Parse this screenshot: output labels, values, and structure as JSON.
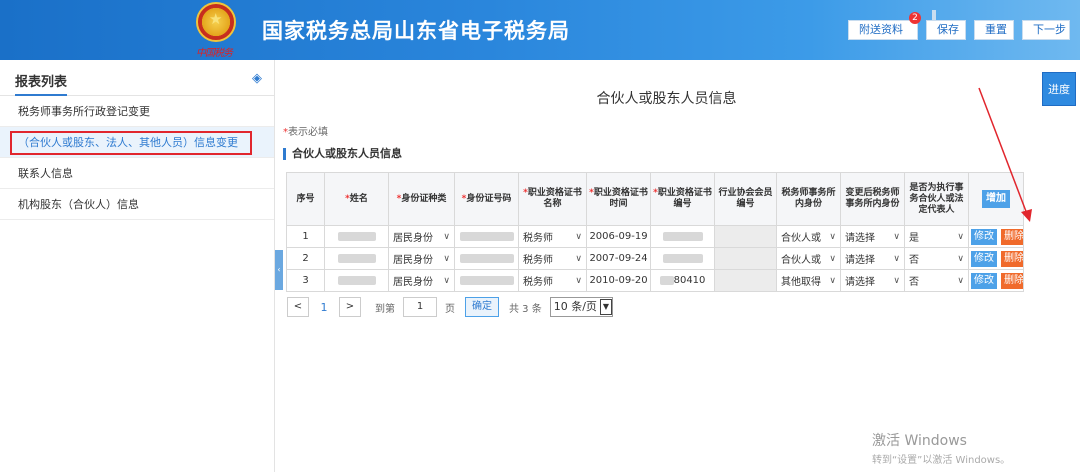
{
  "header": {
    "logo_caption": "中国税务",
    "title": "国家税务总局山东省电子税务局",
    "buttons": [
      {
        "label": "附送资料",
        "badge": "2"
      },
      {
        "label": "保存"
      },
      {
        "label": "重置"
      },
      {
        "label": "下一步"
      }
    ]
  },
  "sidebar": {
    "title": "报表列表",
    "items": [
      {
        "label": "税务师事务所行政登记变更"
      },
      {
        "label": "（合伙人或股东、法人、其他人员）信息变更"
      },
      {
        "label": "联系人信息"
      },
      {
        "label": "机构股东（合伙人）信息"
      }
    ]
  },
  "main": {
    "progress_label": "进度",
    "page_title": "合伙人或股东人员信息",
    "required_note_star": "*",
    "required_note": "表示必填",
    "section_title": "合伙人或股东人员信息",
    "table": {
      "headers": [
        {
          "text": "序号",
          "required": false
        },
        {
          "text": "姓名",
          "required": true
        },
        {
          "text": "身份证种类",
          "required": true
        },
        {
          "text": "身份证号码",
          "required": true
        },
        {
          "text": "职业资格证书名称",
          "required": true
        },
        {
          "text": "职业资格证书时间",
          "required": true
        },
        {
          "text": "职业资格证书编号",
          "required": true
        },
        {
          "text": "行业协会会员编号",
          "required": false
        },
        {
          "text": "税务师事务所内身份",
          "required": false
        },
        {
          "text": "变更后税务师事务所内身份",
          "required": false
        },
        {
          "text": "是否为执行事务合伙人或法定代表人",
          "required": false
        }
      ],
      "add_button": "增加",
      "rows": [
        {
          "index": "1",
          "id_type": "居民身份",
          "cert_name": "税务师",
          "cert_date": "2006-09-19",
          "cert_no_tail": "",
          "role": "合伙人或",
          "new_role": "请选择",
          "executive": "是"
        },
        {
          "index": "2",
          "id_type": "居民身份",
          "cert_name": "税务师",
          "cert_date": "2007-09-24",
          "cert_no_tail": "",
          "role": "合伙人或",
          "new_role": "请选择",
          "executive": "否"
        },
        {
          "index": "3",
          "id_type": "居民身份",
          "cert_name": "税务师",
          "cert_date": "2010-09-20",
          "cert_no_tail": "80410",
          "role": "其他取得",
          "new_role": "请选择",
          "executive": "否"
        }
      ],
      "edit_label": "修改",
      "delete_label": "删除"
    },
    "pager": {
      "prev": "<",
      "current": "1",
      "next": ">",
      "goto_label": "到第",
      "goto_value": "1",
      "page_unit": "页",
      "confirm": "确定",
      "total": "共 3 条",
      "page_size": "10 条/页"
    }
  },
  "watermark": {
    "line1": "激活 Windows",
    "line2": "转到“设置”以激活 Windows。"
  },
  "colors": {
    "header_blue": "#1a70c8",
    "accent_blue": "#2f7bd0",
    "delete_orange": "#f06a2b",
    "annotation_red": "#e1262d"
  }
}
